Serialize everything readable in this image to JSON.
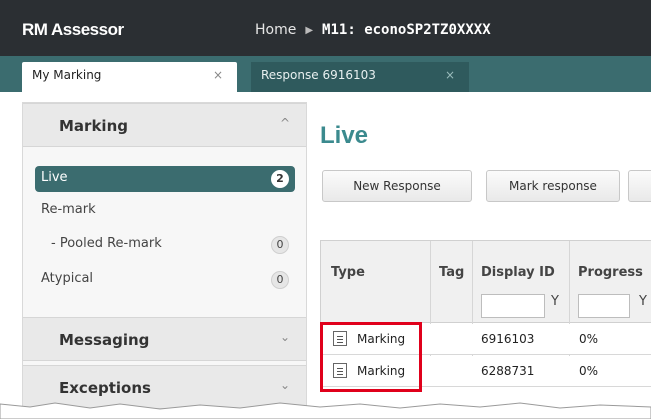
{
  "app": {
    "brand": "RM Assessor",
    "breadcrumb": {
      "home": "Home",
      "current": "M11: econoSP2TZ0XXXX"
    }
  },
  "tabs": [
    {
      "label": "My Marking",
      "close": "×"
    },
    {
      "label": "Response 6916103",
      "close": "×"
    }
  ],
  "sidebar": {
    "marking": {
      "title": "Marking",
      "items": [
        {
          "label": "Live",
          "count": "2"
        },
        {
          "label": "Re-mark",
          "count": ""
        },
        {
          "label": "- Pooled Re-mark",
          "count": "0"
        },
        {
          "label": "Atypical",
          "count": "0"
        }
      ]
    },
    "messaging": {
      "title": "Messaging"
    },
    "exceptions": {
      "title": "Exceptions"
    }
  },
  "content": {
    "title": "Live",
    "buttons": {
      "new_response": "New Response",
      "mark_response": "Mark response"
    },
    "table": {
      "headers": {
        "type": "Type",
        "tag": "Tag",
        "display_id": "Display ID",
        "progress": "Progress"
      },
      "rows": [
        {
          "type": "Marking",
          "tag": "",
          "display_id": "6916103",
          "progress": "0%"
        },
        {
          "type": "Marking",
          "tag": "",
          "display_id": "6288731",
          "progress": "0%"
        }
      ]
    }
  },
  "colors": {
    "topbar": "#2b2f33",
    "teal": "#3b6c6f",
    "title_teal": "#3b8a8e",
    "highlight": "#e0001b"
  }
}
